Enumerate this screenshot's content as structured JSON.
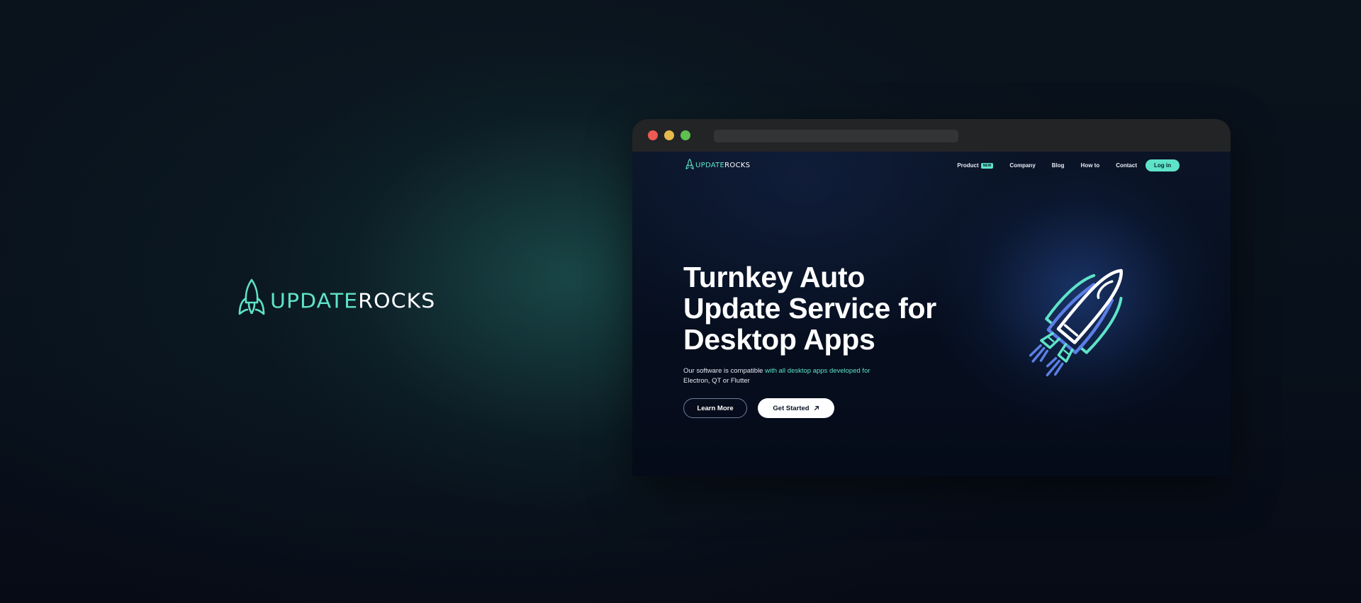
{
  "brand": {
    "word_update": "UPDATE",
    "word_rocks": "ROCKS",
    "accent_color": "#5fe3c8",
    "icon": "rocket-logo-icon"
  },
  "browser": {
    "window_controls": [
      "close-dot",
      "minimize-dot",
      "maximize-dot"
    ],
    "address": ""
  },
  "site": {
    "logo": {
      "word_update": "UPDATE",
      "word_rocks": "ROCKS"
    },
    "nav": {
      "items": [
        {
          "label": "Product",
          "badge": "NEW"
        },
        {
          "label": "Company"
        },
        {
          "label": "Blog"
        },
        {
          "label": "How to"
        },
        {
          "label": "Contact"
        }
      ],
      "login_label": "Log in"
    },
    "hero": {
      "title": "Turnkey Auto\nUpdate Service for\nDesktop Apps",
      "subtitle_plain": "Our software is compatible ",
      "subtitle_highlight": "with all desktop apps developed for",
      "subtitle_end": "Electron, QT or Flutter",
      "learn_more": "Learn More",
      "get_started": "Get Started",
      "get_started_icon": "arrow-up-right-icon",
      "illustration": "rocket-illustration"
    }
  }
}
